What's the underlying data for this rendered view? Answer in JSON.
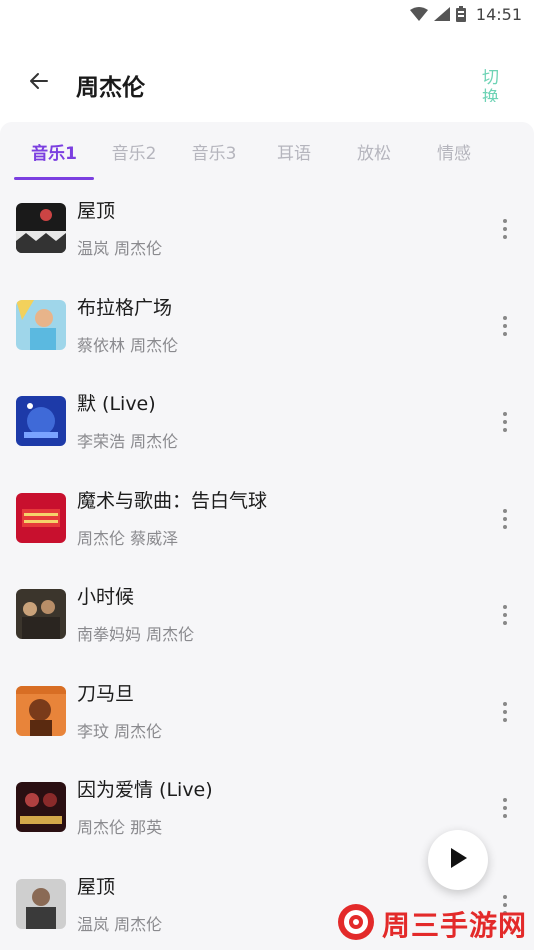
{
  "status_bar": {
    "time": "14:51",
    "icons": [
      "wifi-icon",
      "signal-icon",
      "battery-icon"
    ]
  },
  "header": {
    "title": "周杰伦",
    "back_icon": "arrow-left-icon",
    "switch_label": "切换"
  },
  "tabs": [
    {
      "label": "音乐1",
      "active": true
    },
    {
      "label": "音乐2",
      "active": false
    },
    {
      "label": "音乐3",
      "active": false
    },
    {
      "label": "耳语",
      "active": false
    },
    {
      "label": "放松",
      "active": false
    },
    {
      "label": "情感",
      "active": false
    }
  ],
  "songs": [
    {
      "title": "屋顶",
      "artist": "温岚 周杰伦"
    },
    {
      "title": "布拉格广场",
      "artist": "蔡依林 周杰伦"
    },
    {
      "title": "默 (Live)",
      "artist": "李荣浩 周杰伦"
    },
    {
      "title": "魔术与歌曲：告白气球",
      "artist": "周杰伦 蔡威泽"
    },
    {
      "title": "小时候",
      "artist": "南拳妈妈 周杰伦"
    },
    {
      "title": "刀马旦",
      "artist": "李玟 周杰伦"
    },
    {
      "title": "因为爱情 (Live)",
      "artist": "周杰伦 那英"
    },
    {
      "title": "屋顶",
      "artist": "温岚 周杰伦"
    }
  ],
  "play_button_icon": "play-icon",
  "watermark": {
    "text": "周三手游网"
  },
  "colors": {
    "accent": "#7b3fe0",
    "switch_text": "#6ed3b5",
    "watermark": "#e32a2a",
    "list_background": "#f6f6f8"
  }
}
